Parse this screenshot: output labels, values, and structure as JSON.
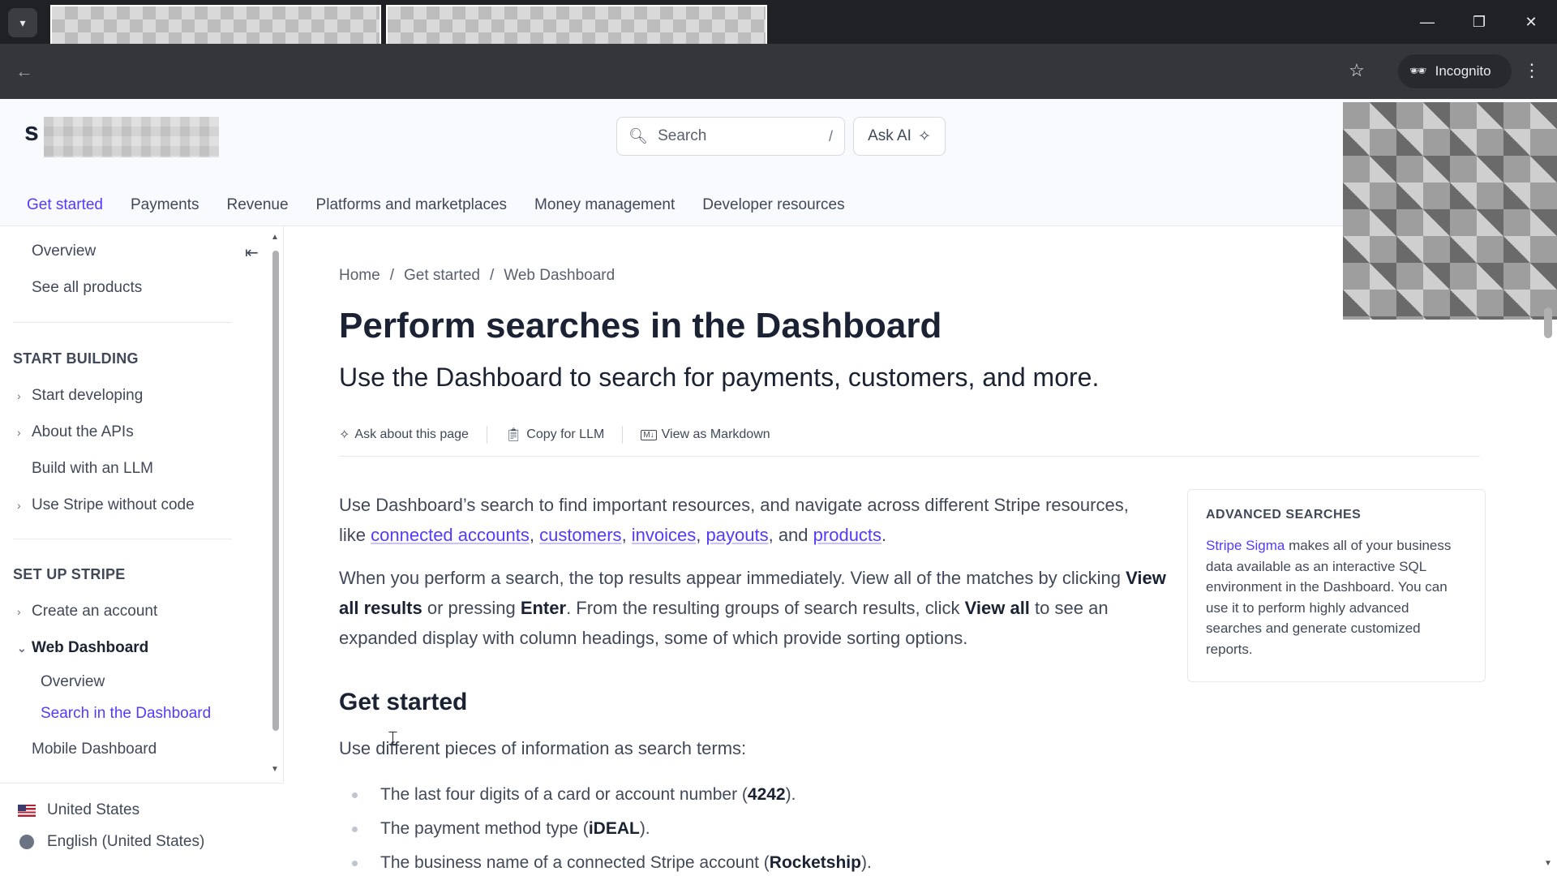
{
  "browser": {
    "incognito_label": "Incognito",
    "minimize": "—",
    "restore": "❐",
    "close": "✕"
  },
  "header": {
    "logo_text": "s",
    "search_placeholder": "Search",
    "search_shortcut": "/",
    "ask_ai_label": "Ask AI",
    "nav": [
      "Get started",
      "Payments",
      "Revenue",
      "Platforms and marketplaces",
      "Money management",
      "Developer resources"
    ]
  },
  "sidebar": {
    "top_items": [
      "Overview",
      "See all products"
    ],
    "start_building": {
      "heading": "START BUILDING",
      "items": [
        "Start developing",
        "About the APIs",
        "Build with an LLM",
        "Use Stripe without code"
      ]
    },
    "set_up_stripe": {
      "heading": "SET UP STRIPE",
      "items": [
        "Create an account",
        "Web Dashboard",
        "Overview",
        "Search in the Dashboard",
        "Mobile Dashboard"
      ]
    },
    "country": "United States",
    "language": "English (United States)"
  },
  "main": {
    "breadcrumb": [
      "Home",
      "Get started",
      "Web Dashboard"
    ],
    "breadcrumb_sep": "/",
    "title": "Perform searches in the Dashboard",
    "subtitle": "Use the Dashboard to search for payments, customers, and more.",
    "tools": [
      "Ask about this page",
      "Copy for LLM",
      "View as Markdown"
    ],
    "para1_text": "Use Dashboard’s search to find important resources, and navigate across different Stripe resources, like",
    "para1_links": [
      "connected accounts",
      "customers",
      "invoices",
      "payouts",
      "products"
    ],
    "para1_and": "and",
    "para2_a": "When you perform a search, the top results appear immediately. View all of the matches by clicking",
    "para2_b1": "View all results",
    "para2_b": "or pressing",
    "para2_b2": "Enter",
    "para2_c": ". From the resulting groups of search results, click",
    "para2_b3": "View all",
    "para2_d": "to see an expanded display with column headings, some of which provide sorting options.",
    "h2": "Get started",
    "intro": "Use different pieces of information as search terms:",
    "bullets": [
      {
        "text": "The last four digits of a card or account number (",
        "bold": "4242",
        "end": ")."
      },
      {
        "text": "The payment method type (",
        "bold": "iDEAL",
        "end": ")."
      },
      {
        "text": "The business name of a connected Stripe account (",
        "bold": "Rocketship",
        "end": ")."
      }
    ]
  },
  "aside": {
    "title": "ADVANCED SEARCHES",
    "link": "Stripe Sigma",
    "body": "makes all of your business data available as an interactive SQL environment in the Dashboard. You can use it to perform highly advanced searches and generate customized reports."
  }
}
